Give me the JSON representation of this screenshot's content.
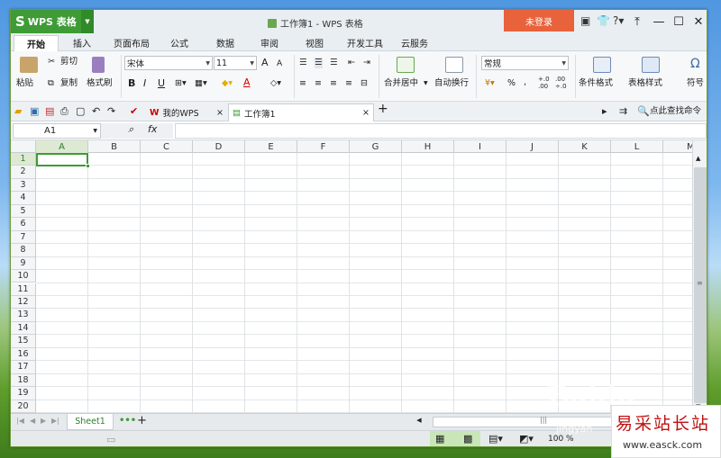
{
  "app": {
    "name": "WPS 表格",
    "logo_glyph": "S",
    "title": "工作簿1 - WPS 表格",
    "login_label": "未登录",
    "help_label": "?"
  },
  "menu": {
    "tabs": [
      "开始",
      "插入",
      "页面布局",
      "公式",
      "数据",
      "审阅",
      "视图",
      "开发工具",
      "云服务"
    ],
    "active": 0
  },
  "ribbon": {
    "paste": "粘贴",
    "cut": "剪切",
    "copy": "复制",
    "format_painter": "格式刷",
    "font_name": "宋体",
    "font_size": "11",
    "bold": "B",
    "italic": "I",
    "underline": "U",
    "merge": "合并居中",
    "wrap": "自动换行",
    "number_format": "常规",
    "percent": "%",
    "comma": "‚",
    "dec_inc": "+.0 .00",
    "dec_dec": ".00 ÷.0",
    "cond_format": "条件格式",
    "table_style": "表格样式",
    "symbol": "符号",
    "font_color_letter": "A",
    "grow_font": "A",
    "shrink_font": "A"
  },
  "doctabs": [
    {
      "label": "我的WPS",
      "close": "×"
    },
    {
      "label": "工作簿1",
      "close": "×"
    }
  ],
  "new_tab": "+",
  "find_command": "点此查找命令",
  "formula_bar": {
    "name_box": "A1",
    "fx": "fx",
    "value": ""
  },
  "grid": {
    "columns": [
      "A",
      "B",
      "C",
      "D",
      "E",
      "F",
      "G",
      "H",
      "I",
      "J",
      "K",
      "L",
      "M"
    ],
    "rows": [
      "1",
      "2",
      "3",
      "4",
      "5",
      "6",
      "7",
      "8",
      "9",
      "10",
      "11",
      "12",
      "13",
      "14",
      "15",
      "16",
      "17",
      "18",
      "19",
      "20"
    ],
    "selected": "A1"
  },
  "sheets": {
    "tabs": [
      "Sheet1"
    ],
    "more": "•••",
    "add": "+"
  },
  "status": {
    "zoom": "100 %"
  },
  "watermark": {
    "brand": "Baidu",
    "sub": "jingyan",
    "site_cn": "易采站长站",
    "site_url": "www.easck.com"
  },
  "colors": {
    "green": "#3e9b35",
    "orange": "#e8623b"
  }
}
